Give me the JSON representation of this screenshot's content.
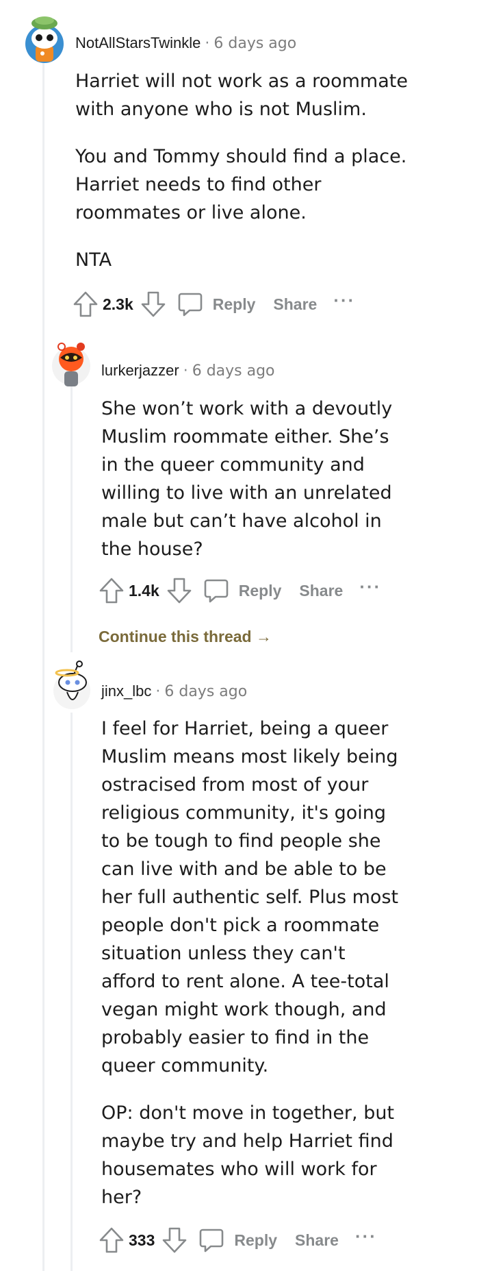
{
  "comments": [
    {
      "username": "NotAllStarsTwinkle",
      "separator": "·",
      "time": "6 days ago",
      "paragraphs": [
        "Harriet will not work as a roommate with anyone who is not Muslim.",
        "You and Tommy should find a place. Harriet needs to find other roommates or live alone.",
        "NTA"
      ],
      "votes": "2.3k",
      "reply_label": "Reply",
      "share_label": "Share",
      "more_label": "···"
    },
    {
      "username": "lurkerjazzer",
      "separator": "·",
      "time": "6 days ago",
      "paragraphs": [
        "She won’t work with a devoutly Muslim roommate either. She’s in the queer community and willing to live with an unrelated male but can’t have alcohol in the house?"
      ],
      "votes": "1.4k",
      "reply_label": "Reply",
      "share_label": "Share",
      "more_label": "···",
      "continue_label": "Continue this thread →"
    },
    {
      "username": "jinx_lbc",
      "separator": "·",
      "time": "6 days ago",
      "paragraphs": [
        "I feel for Harriet, being a queer Muslim means most likely being ostracised from most of your religious community, it's going to be tough to find people she can live with and be able to be her full authentic self. Plus most people don't pick a roommate situation unless they can't afford to rent alone. A tee-total vegan might work though, and probably easier to find in the queer community.",
        "OP: don't move in together, but maybe try and help Harriet find housemates who will work for her?"
      ],
      "votes": "333",
      "reply_label": "Reply",
      "share_label": "Share",
      "more_label": "···"
    }
  ],
  "colors": {
    "thread_line": "#edeff1",
    "meta_gray": "#7c7c7c",
    "action_gray": "#878a8c",
    "continue_link": "#7a6a3a"
  },
  "icons": [
    "upvote-icon",
    "downvote-icon",
    "comment-icon",
    "avatar-snoo"
  ]
}
